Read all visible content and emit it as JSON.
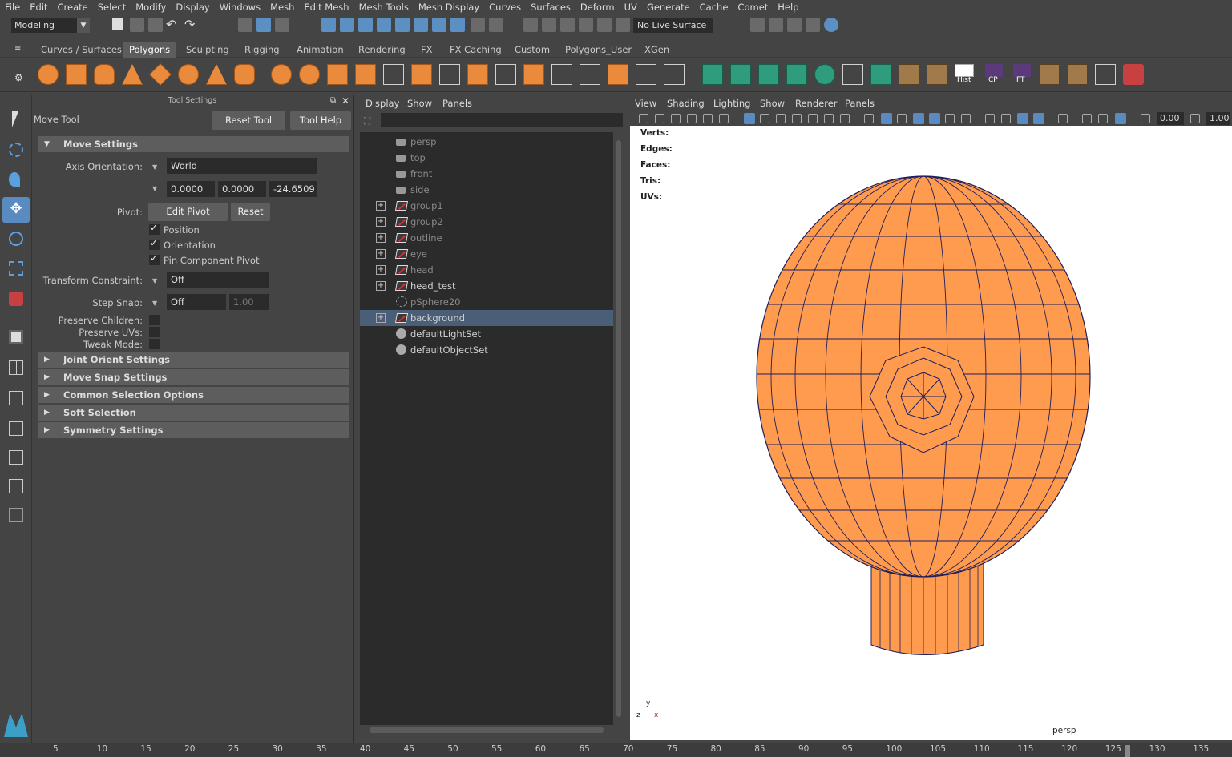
{
  "menubar": [
    "File",
    "Edit",
    "Create",
    "Select",
    "Modify",
    "Display",
    "Windows",
    "Mesh",
    "Edit Mesh",
    "Mesh Tools",
    "Mesh Display",
    "Curves",
    "Surfaces",
    "Deform",
    "UV",
    "Generate",
    "Cache",
    "Comet",
    "Help"
  ],
  "status": {
    "mode": "Modeling",
    "live_surface": "No Live Surface"
  },
  "shelf_tabs": [
    "Curves / Surfaces",
    "Polygons",
    "Sculpting",
    "Rigging",
    "Animation",
    "Rendering",
    "FX",
    "FX Caching",
    "Custom",
    "Polygons_User",
    "XGen"
  ],
  "shelf_labels": {
    "hist": "Hist",
    "cp": "CP",
    "ft": "FT"
  },
  "tool_settings": {
    "header": "Tool Settings",
    "tool_name": "Move Tool",
    "reset_tool": "Reset Tool",
    "tool_help": "Tool Help",
    "move_settings": "Move Settings",
    "axis_orientation_label": "Axis Orientation:",
    "axis_orientation": "World",
    "axis_values": [
      "0.0000",
      "0.0000",
      "-24.6509"
    ],
    "pivot_label": "Pivot:",
    "edit_pivot": "Edit Pivot",
    "reset": "Reset",
    "position": "Position",
    "orientation": "Orientation",
    "pin_component_pivot": "Pin Component Pivot",
    "transform_constraint_label": "Transform Constraint:",
    "transform_constraint": "Off",
    "step_snap_label": "Step Snap:",
    "step_snap": "Off",
    "step_snap_value": "1.00",
    "preserve_children": "Preserve Children:",
    "preserve_uvs": "Preserve UVs:",
    "tweak_mode": "Tweak Mode:",
    "sections": [
      "Joint Orient Settings",
      "Move Snap Settings",
      "Common Selection Options",
      "Soft Selection",
      "Symmetry Settings"
    ]
  },
  "outliner": {
    "menu": [
      "Display",
      "Show",
      "Panels"
    ],
    "items": [
      {
        "name": "persp",
        "type": "camera",
        "dim": true,
        "expand": false
      },
      {
        "name": "top",
        "type": "camera",
        "dim": true,
        "expand": false
      },
      {
        "name": "front",
        "type": "camera",
        "dim": true,
        "expand": false
      },
      {
        "name": "side",
        "type": "camera",
        "dim": true,
        "expand": false
      },
      {
        "name": "group1",
        "type": "group",
        "dim": true,
        "expand": true
      },
      {
        "name": "group2",
        "type": "group",
        "dim": true,
        "expand": true
      },
      {
        "name": "outline",
        "type": "group",
        "dim": true,
        "expand": true
      },
      {
        "name": "eye",
        "type": "group",
        "dim": true,
        "expand": true
      },
      {
        "name": "head",
        "type": "group",
        "dim": true,
        "expand": true
      },
      {
        "name": "head_test",
        "type": "group",
        "dim": false,
        "expand": true
      },
      {
        "name": "pSphere20",
        "type": "sphere",
        "dim": true,
        "expand": false
      },
      {
        "name": "background",
        "type": "group",
        "dim": false,
        "expand": true,
        "selected": true
      },
      {
        "name": "defaultLightSet",
        "type": "set",
        "dim": false,
        "expand": false
      },
      {
        "name": "defaultObjectSet",
        "type": "set",
        "dim": false,
        "expand": false
      }
    ]
  },
  "viewport": {
    "menu": [
      "View",
      "Shading",
      "Lighting",
      "Show",
      "Renderer",
      "Panels"
    ],
    "field1": "0.00",
    "field2": "1.00",
    "hud": [
      "Verts:",
      "Edges:",
      "Faces:",
      "Tris:",
      "UVs:"
    ],
    "camera": "persp",
    "axis_y": "y",
    "axis_z": "z",
    "axis_x": "x",
    "mesh_color": "#FF9B4F"
  },
  "timeline": [
    "5",
    "10",
    "15",
    "20",
    "25",
    "30",
    "35",
    "40",
    "45",
    "50",
    "55",
    "60",
    "65",
    "70",
    "75",
    "80",
    "85",
    "90",
    "95",
    "100",
    "105",
    "110",
    "115",
    "120",
    "125",
    "130",
    "135"
  ]
}
